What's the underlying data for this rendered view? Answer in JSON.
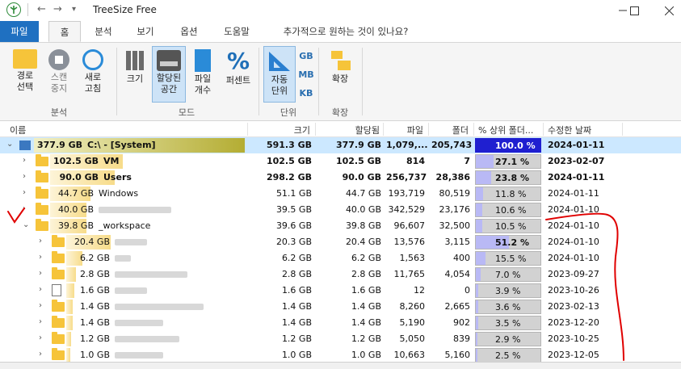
{
  "window": {
    "title": "TreeSize Free"
  },
  "tabs": [
    {
      "label": "파일"
    },
    {
      "label": "홈"
    },
    {
      "label": "분석"
    },
    {
      "label": "보기"
    },
    {
      "label": "옵션"
    },
    {
      "label": "도움말"
    },
    {
      "label": "추가적으로 원하는 것이 있나요?"
    }
  ],
  "ribbon": {
    "path_select": "경로\n선택",
    "scan_stop": "스캔\n중지",
    "refresh": "새로\n고침",
    "group_analysis": "분석",
    "size": "크기",
    "allocated": "할당된\n공간",
    "file_count": "파일\n개수",
    "percent": "퍼센트",
    "group_mode": "모드",
    "auto_unit": "자동\n단위",
    "gb": "GB",
    "mb": "MB",
    "kb": "KB",
    "group_unit": "단위",
    "expand": "확장",
    "group_expand": "확장"
  },
  "columns": [
    "이름",
    "크기",
    "할당됨",
    "파일",
    "폴더",
    "% 상위 폴더...",
    "수정한 날짜"
  ],
  "rows": [
    {
      "size_label": "377.9 GB",
      "name": "C:\\  -  [System]",
      "size": "591.3 GB",
      "alloc": "377.9 GB",
      "files": "1,079,...",
      "folders": "205,743",
      "pct": "100.0 %",
      "pct_value": 100.0,
      "date": "2024-01-11"
    },
    {
      "size_label": "102.5 GB",
      "name": "VM",
      "size": "102.5 GB",
      "alloc": "102.5 GB",
      "files": "814",
      "folders": "7",
      "pct": "27.1 %",
      "pct_value": 27.1,
      "date": "2023-02-07"
    },
    {
      "size_label": "90.0 GB",
      "name": "Users",
      "size": "298.2 GB",
      "alloc": "90.0 GB",
      "files": "256,737",
      "folders": "28,386",
      "pct": "23.8 %",
      "pct_value": 23.8,
      "date": "2024-01-11"
    },
    {
      "size_label": "44.7 GB",
      "name": "Windows",
      "size": "51.1 GB",
      "alloc": "44.7 GB",
      "files": "193,719",
      "folders": "80,519",
      "pct": "11.8 %",
      "pct_value": 11.8,
      "date": "2024-01-11"
    },
    {
      "size_label": "40.0 GB",
      "name": "",
      "size": "39.5 GB",
      "alloc": "40.0 GB",
      "files": "342,529",
      "folders": "23,176",
      "pct": "10.6 %",
      "pct_value": 10.6,
      "date": "2024-01-10"
    },
    {
      "size_label": "39.8 GB",
      "name": "_workspace",
      "size": "39.6 GB",
      "alloc": "39.8 GB",
      "files": "96,607",
      "folders": "32,500",
      "pct": "10.5 %",
      "pct_value": 10.5,
      "date": "2024-01-10"
    },
    {
      "size_label": "20.4 GB",
      "name": "",
      "size": "20.3 GB",
      "alloc": "20.4 GB",
      "files": "13,576",
      "folders": "3,115",
      "pct": "51.2 %",
      "pct_value": 51.2,
      "date": "2024-01-10"
    },
    {
      "size_label": "6.2 GB",
      "name": "",
      "size": "6.2 GB",
      "alloc": "6.2 GB",
      "files": "1,563",
      "folders": "400",
      "pct": "15.5 %",
      "pct_value": 15.5,
      "date": "2024-01-10"
    },
    {
      "size_label": "2.8 GB",
      "name": "",
      "size": "2.8 GB",
      "alloc": "2.8 GB",
      "files": "11,765",
      "folders": "4,054",
      "pct": "7.0 %",
      "pct_value": 7.0,
      "date": "2023-09-27"
    },
    {
      "size_label": "1.6 GB",
      "name": "",
      "size": "1.6 GB",
      "alloc": "1.6 GB",
      "files": "12",
      "folders": "0",
      "pct": "3.9 %",
      "pct_value": 3.9,
      "date": "2023-10-26"
    },
    {
      "size_label": "1.4 GB",
      "name": "",
      "size": "1.4 GB",
      "alloc": "1.4 GB",
      "files": "8,260",
      "folders": "2,665",
      "pct": "3.6 %",
      "pct_value": 3.6,
      "date": "2023-02-13"
    },
    {
      "size_label": "1.4 GB",
      "name": "",
      "size": "1.4 GB",
      "alloc": "1.4 GB",
      "files": "5,190",
      "folders": "902",
      "pct": "3.5 %",
      "pct_value": 3.5,
      "date": "2023-12-20"
    },
    {
      "size_label": "1.2 GB",
      "name": "",
      "size": "1.2 GB",
      "alloc": "1.2 GB",
      "files": "5,050",
      "folders": "839",
      "pct": "2.9 %",
      "pct_value": 2.9,
      "date": "2023-10-25"
    },
    {
      "size_label": "1.0 GB",
      "name": "",
      "size": "1.0 GB",
      "alloc": "1.0 GB",
      "files": "10,663",
      "folders": "5,160",
      "pct": "2.5 %",
      "pct_value": 2.5,
      "date": "2023-12-05"
    }
  ],
  "colors": {
    "accent": "#1f70c1",
    "selection": "#cce8ff",
    "bar": "#b9b9f5",
    "root_bar": "#b4ad33",
    "annotation": "#e00000"
  }
}
